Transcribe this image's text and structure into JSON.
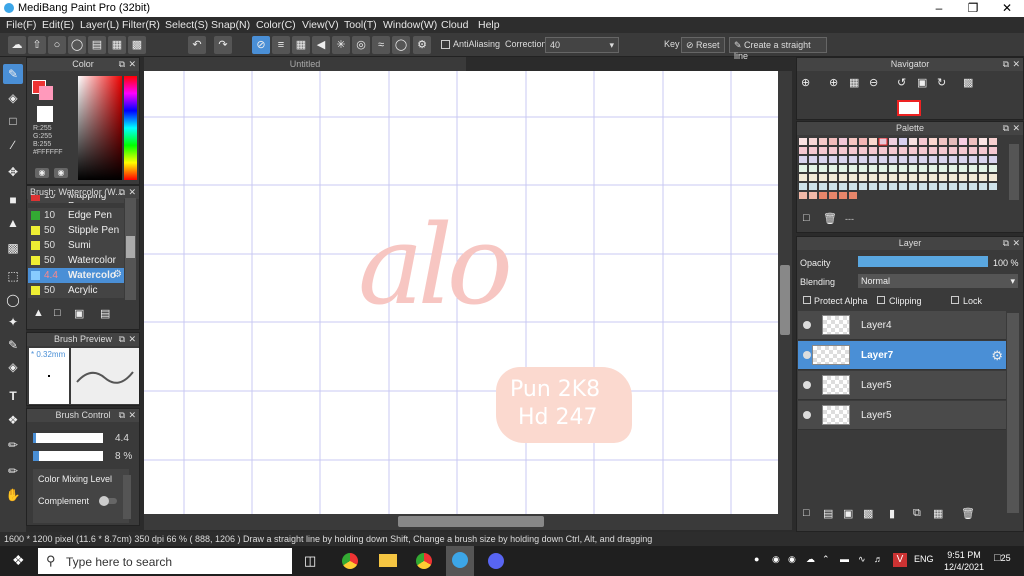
{
  "window": {
    "title": "MediBang Paint Pro (32bit)"
  },
  "menu": [
    "File(F)",
    "Edit(E)",
    "Layer(L)",
    "Filter(R)",
    "Select(S)",
    "Snap(N)",
    "Color(C)",
    "View(V)",
    "Tool(T)",
    "Window(W)",
    "Cloud",
    "Help"
  ],
  "toolbar": {
    "antialiasing": "AntiAliasing",
    "correction_label": "Correction",
    "correction_value": "40",
    "key_label": "Key",
    "reset_label": "Reset",
    "straight_line_label": "Create a straight line"
  },
  "canvas": {
    "tab_title": "Untitled",
    "drawing_text": "alo",
    "watermark_line1": "Pun 2K8",
    "watermark_line2": "Hd 247"
  },
  "color_panel": {
    "title": "Color",
    "rgb_r": "R:255",
    "rgb_g": "G:255",
    "rgb_b": "B:255",
    "hex": "#FFFFFF"
  },
  "brush_panel": {
    "title": "Brush: Watercolor (W...",
    "items": [
      {
        "size": "15",
        "name": "Mapping Pen",
        "color": "#d33"
      },
      {
        "size": "10",
        "name": "Edge Pen",
        "color": "#3a3"
      },
      {
        "size": "50",
        "name": "Stipple Pen",
        "color": "#ee3"
      },
      {
        "size": "50",
        "name": "Sumi",
        "color": "#ee3"
      },
      {
        "size": "50",
        "name": "Watercolor",
        "color": "#ee3"
      },
      {
        "size": "4.4",
        "name": "Watercolo",
        "color": "#8cf"
      },
      {
        "size": "50",
        "name": "Acrylic",
        "color": "#ee3"
      }
    ]
  },
  "brush_preview": {
    "title": "Brush Preview",
    "size": "* 0.32mm"
  },
  "brush_control": {
    "title": "Brush Control",
    "size_value": "4.4",
    "opacity_value": "8 %",
    "color_mixing": "Color Mixing Level",
    "complement": "Complement"
  },
  "navigator": {
    "title": "Navigator"
  },
  "palette": {
    "title": "Palette",
    "name": "---"
  },
  "layer_panel": {
    "title": "Layer",
    "opacity_label": "Opacity",
    "opacity_value": "100 %",
    "opacity_fraction": 1.0,
    "blending_label": "Blending",
    "blending_value": "Normal",
    "protect_alpha": "Protect Alpha",
    "clipping": "Clipping",
    "lock": "Lock",
    "layers": [
      {
        "name": "Layer4",
        "selected": false
      },
      {
        "name": "Layer7",
        "selected": true
      },
      {
        "name": "Layer5",
        "selected": false
      },
      {
        "name": "Layer5",
        "selected": false
      }
    ]
  },
  "status": {
    "text": "1600 * 1200 pixel    (11.6 * 8.7cm)   350 dpi   66 %   ( 888, 1206 )   Draw a straight line by holding down Shift, Change a brush size by holding down Ctrl, Alt, and dragging"
  },
  "taskbar": {
    "search_placeholder": "Type here to search",
    "lang": "ENG",
    "time": "9:51 PM",
    "date": "12/4/2021",
    "notif_count": "25"
  }
}
